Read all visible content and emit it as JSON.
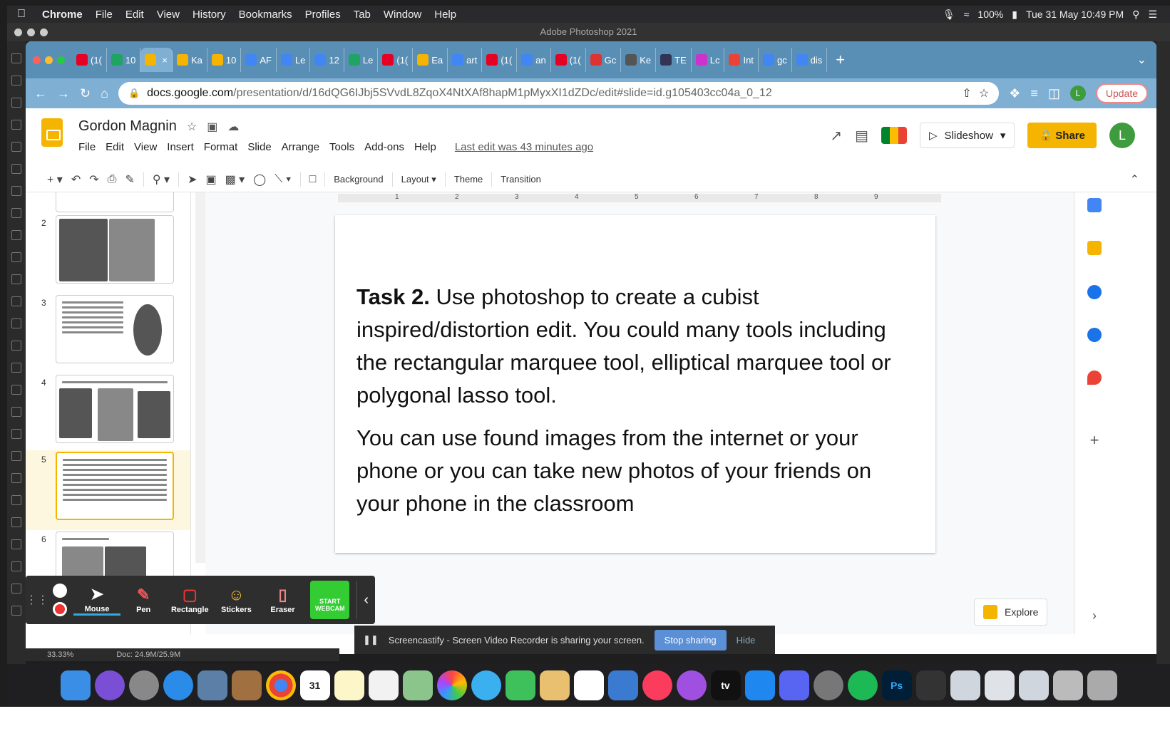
{
  "menubar": {
    "app": "Chrome",
    "items": [
      "File",
      "Edit",
      "View",
      "History",
      "Bookmarks",
      "Profiles",
      "Tab",
      "Window",
      "Help"
    ],
    "battery": "100%",
    "datetime": "Tue 31 May  10:49 PM"
  },
  "photoshop": {
    "window_title": "Adobe Photoshop 2021",
    "zoom": "33.33%",
    "doc_size": "Doc: 24.9M/25.9M"
  },
  "tabs": [
    {
      "label": "(1(",
      "color": "#e60023"
    },
    {
      "label": "10",
      "color": "#1fa463"
    },
    {
      "label": "",
      "color": "#f4b400",
      "active": true
    },
    {
      "label": "Ka",
      "color": "#f4b400"
    },
    {
      "label": "10",
      "color": "#f4b400"
    },
    {
      "label": "AF",
      "color": "#4285f4"
    },
    {
      "label": "Le",
      "color": "#4285f4"
    },
    {
      "label": "12",
      "color": "#4285f4"
    },
    {
      "label": "Le",
      "color": "#1fa463"
    },
    {
      "label": "(1(",
      "color": "#e60023"
    },
    {
      "label": "Ea",
      "color": "#f4b400"
    },
    {
      "label": "art",
      "color": "#4285f4"
    },
    {
      "label": "(1(",
      "color": "#e60023"
    },
    {
      "label": "an",
      "color": "#4285f4"
    },
    {
      "label": "(1(",
      "color": "#e60023"
    },
    {
      "label": "Gc",
      "color": "#d33"
    },
    {
      "label": "Ke",
      "color": "#555"
    },
    {
      "label": "TE",
      "color": "#335"
    },
    {
      "label": "Lc",
      "color": "#c3c"
    },
    {
      "label": "Int",
      "color": "#ea4335"
    },
    {
      "label": "gc",
      "color": "#4285f4"
    },
    {
      "label": "dis",
      "color": "#4285f4"
    }
  ],
  "address": {
    "host": "docs.google.com",
    "path": "/presentation/d/16dQG6IJbj5SVvdL8ZqoX4NtXAf8hapM1pMyxXI1dZDc/edit#slide=id.g105403cc04a_0_12",
    "update_label": "Update",
    "profile_initial": "L"
  },
  "doc": {
    "title": "Gordon Magnin",
    "menu": [
      "File",
      "Edit",
      "View",
      "Insert",
      "Format",
      "Slide",
      "Arrange",
      "Tools",
      "Add-ons",
      "Help"
    ],
    "last_edit": "Last edit was 43 minutes ago",
    "slideshow_label": "Slideshow",
    "share_label": "Share",
    "user_initial": "L"
  },
  "toolbar": {
    "background": "Background",
    "layout": "Layout",
    "theme": "Theme",
    "transition": "Transition"
  },
  "ruler_marks": [
    "1",
    "2",
    "3",
    "4",
    "5",
    "6",
    "7",
    "8",
    "9"
  ],
  "filmstrip": {
    "numbers": [
      "2",
      "3",
      "4",
      "5",
      "6"
    ],
    "selected": "5"
  },
  "slide": {
    "task_bold": "Task 2.",
    "paragraph1": " Use photoshop to create a cubist inspired/distortion edit. You could many tools including the rectangular marquee tool, elliptical marquee tool or polygonal lasso tool.",
    "paragraph2": "You can use found images from the internet or your phone or you can take new photos of your friends on your phone in the classroom"
  },
  "explore_label": "Explore",
  "screencastify": {
    "tools": [
      "Mouse",
      "Pen",
      "Rectangle",
      "Stickers",
      "Eraser"
    ],
    "webcam": "START WEBCAM",
    "notice": "Screencastify - Screen Video Recorder is sharing your screen.",
    "stop_label": "Stop sharing",
    "hide_label": "Hide"
  },
  "dock": {
    "calendar_day": "31",
    "ps_label": "Ps",
    "tv_label": "tv"
  }
}
